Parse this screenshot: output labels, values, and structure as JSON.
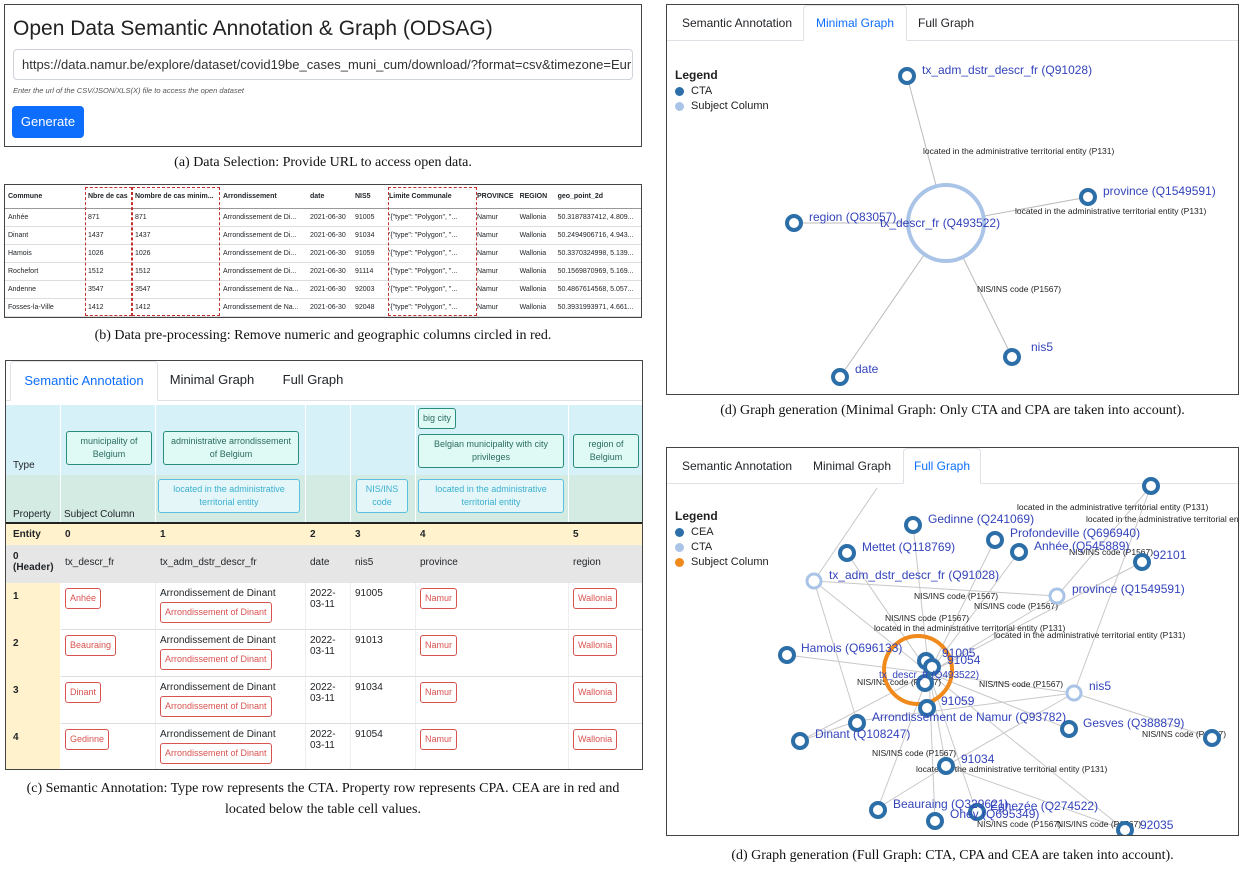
{
  "panel_a": {
    "title": "Open Data Semantic Annotation & Graph (ODSAG)",
    "url_value": "https://data.namur.be/explore/dataset/covid19be_cases_muni_cum/download/?format=csv&timezone=Eur",
    "hint": "Enter the url of the CSV/JSON/XLS(X) file to access the open dataset",
    "generate_label": "Generate",
    "caption": "(a) Data Selection: Provide URL to access open data."
  },
  "panel_b": {
    "headers": [
      "Commune",
      "Nbre de cas",
      "Nombre de cas minim...",
      "Arrondissement",
      "date",
      "NIS5",
      "Limite Communale",
      "PROVINCE",
      "REGION",
      "geo_point_2d"
    ],
    "rows": [
      [
        "Anhée",
        "871",
        "871",
        "Arrondissement de Di...",
        "2021-06-30",
        "91005",
        "'{\"type\": \"Polygon\", \"...",
        "Namur",
        "Wallonia",
        "50.3187837412, 4.809..."
      ],
      [
        "Dinant",
        "1437",
        "1437",
        "Arrondissement de Di...",
        "2021-06-30",
        "91034",
        "'{\"type\": \"Polygon\", \"...",
        "Namur",
        "Wallonia",
        "50.2494906716, 4.943..."
      ],
      [
        "Hamois",
        "1026",
        "1026",
        "Arrondissement de Di...",
        "2021-06-30",
        "91059",
        "'{\"type\": \"Polygon\", \"...",
        "Namur",
        "Wallonia",
        "50.3370324998, 5.139..."
      ],
      [
        "Rochefort",
        "1512",
        "1512",
        "Arrondissement de Di...",
        "2021-06-30",
        "91114",
        "'{\"type\": \"Polygon\", \"...",
        "Namur",
        "Wallonia",
        "50.1569870969, 5.169..."
      ],
      [
        "Andenne",
        "3547",
        "3547",
        "Arrondissement de Na...",
        "2021-06-30",
        "92003",
        "'{\"type\": \"Polygon\", \"...",
        "Namur",
        "Wallonia",
        "50.4867614568, 5.057..."
      ],
      [
        "Fosses-la-Ville",
        "1412",
        "1412",
        "Arrondissement de Na...",
        "2021-06-30",
        "92048",
        "'{\"type\": \"Polygon\", \"...",
        "Namur",
        "Wallonia",
        "50.3931993971, 4.661..."
      ]
    ],
    "caption": "(b) Data pre-processing: Remove numeric and geographic columns circled in red."
  },
  "tabs": {
    "semantic": "Semantic Annotation",
    "minimal": "Minimal Graph",
    "full": "Full Graph"
  },
  "panel_c": {
    "type_label": "Type",
    "property_label": "Property",
    "subject_column_label": "Subject Column",
    "type_tags": [
      "municipality of Belgium",
      "administrative arrondissement of Belgium",
      "big city",
      "Belgian municipality with city privileges",
      "region of Belgium"
    ],
    "property_tags": [
      "located in the administrative territorial entity",
      "NIS/INS code",
      "located in the administrative territorial entity"
    ],
    "entity_label": "Entity",
    "entity_cols": [
      "0",
      "1",
      "2",
      "3",
      "4",
      "5"
    ],
    "header_label": "0 (Header)",
    "header_cols": [
      "tx_descr_fr",
      "tx_adm_dstr_descr_fr",
      "date",
      "nis5",
      "province",
      "region"
    ],
    "rows": [
      {
        "idx": "1",
        "c0": "Anhée",
        "c1": "Arrondissement de Dinant",
        "c1e": "Arrondissement of Dinant",
        "c2": "2022-03-11",
        "c3": "91005",
        "c4": "Namur",
        "c5": "Wallonia"
      },
      {
        "idx": "2",
        "c0": "Beauraing",
        "c1": "Arrondissement de Dinant",
        "c1e": "Arrondissement of Dinant",
        "c2": "2022-03-11",
        "c3": "91013",
        "c4": "Namur",
        "c5": "Wallonia"
      },
      {
        "idx": "3",
        "c0": "Dinant",
        "c1": "Arrondissement de Dinant",
        "c1e": "Arrondissement of Dinant",
        "c2": "2022-03-11",
        "c3": "91034",
        "c4": "Namur",
        "c5": "Wallonia"
      },
      {
        "idx": "4",
        "c0": "Gedinne",
        "c1": "Arrondissement de Dinant",
        "c1e": "Arrondissement of Dinant",
        "c2": "2022-03-11",
        "c3": "91054",
        "c4": "Namur",
        "c5": "Wallonia"
      }
    ],
    "caption": "(c) Semantic Annotation: Type row represents the CTA. Property row represents CPA. CEA are in red and located below the table cell values."
  },
  "panel_d": {
    "legend_title": "Legend",
    "legend": [
      {
        "label": "CTA",
        "color": "#2c6ea8"
      },
      {
        "label": "Subject Column",
        "color": "#a9c4e6"
      }
    ],
    "nodes": [
      "tx_adm_dstr_descr_fr (Q91028)",
      "province (Q1549591)",
      "region (Q83057)",
      "tx_descr_fr (Q493522)",
      "nis5",
      "date"
    ],
    "edges": [
      "located in the administrative territorial entity (P131)",
      "located in the administrative territorial entity (P131)",
      "NIS/INS code (P1567)"
    ],
    "caption": "(d) Graph generation (Minimal Graph: Only CTA and CPA are taken into account)."
  },
  "panel_e": {
    "legend_title": "Legend",
    "legend": [
      {
        "label": "CEA",
        "color": "#2c6ea8"
      },
      {
        "label": "CTA",
        "color": "#a9c4e6"
      },
      {
        "label": "Subject Column",
        "color": "#f08a1c"
      }
    ],
    "nodes": [
      "Gedinne (Q241069)",
      "Profondeville (Q696940)",
      "Mettet (Q118769)",
      "Anhée (Q545889)",
      "92101",
      "tx_adm_dstr_descr_fr (Q91028)",
      "province (Q1549591)",
      "Hamois (Q696133)",
      "91005",
      "91054",
      "tx_descr_fr (Q493522)",
      "nis5",
      "91059",
      "Arrondissement de Namur (Q93782)",
      "Gesves (Q388879)",
      "Dinant (Q108247)",
      "91034",
      "Beauraing (Q329621)",
      "Ohey (Q695349)",
      "Eghezée (Q274522)",
      "92035"
    ],
    "edge_labels": [
      "located in the administrative territorial entity (P131)",
      "located in the administrative territorial entity (P131)",
      "located in the administrative territorial entit",
      "NIS/INS code (P1567)",
      "NIS/INS code (P1567)",
      "NIS/INS code (P1567)",
      "located in the administrative territorial entity (P131)",
      "located in the administrative territorial entity (P131)",
      "NIS/INS code (P1567)",
      "NIS/INS code (P1567)",
      "NIS/INS code (P1567)",
      "NIS/INS code (P1567)",
      "located in the administrative territorial entity (P131)",
      "NIS/INS code (P1567)",
      "NIS/INS code (P1567)",
      "NIS/INS code (P1567)",
      "NIS/INS code (P1567)"
    ],
    "caption": "(d) Graph generation (Full Graph: CTA, CPA and CEA are taken into account)."
  }
}
